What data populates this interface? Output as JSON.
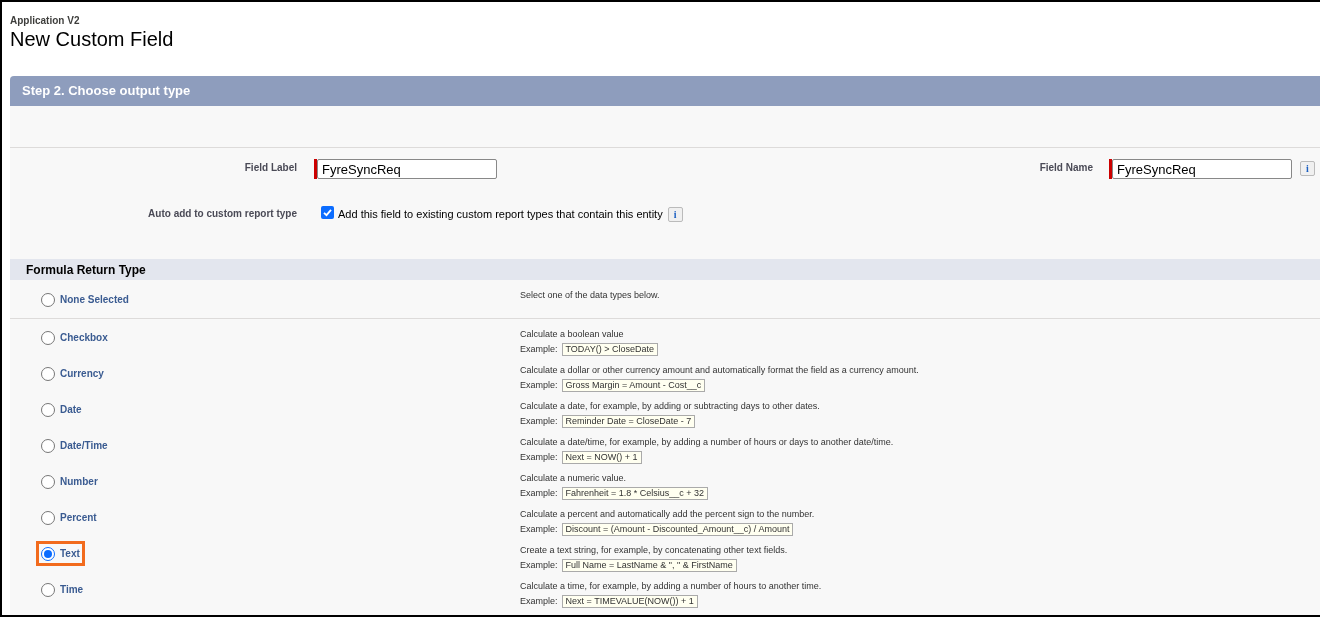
{
  "breadcrumb": "Application V2",
  "title": "New Custom Field",
  "step_header": "Step 2. Choose output type",
  "field_label": {
    "label": "Field Label",
    "value": "FyreSyncReq"
  },
  "field_name": {
    "label": "Field Name",
    "value": "FyreSyncReq",
    "info": "i"
  },
  "auto_add": {
    "label": "Auto add to custom report type",
    "checked": true,
    "text": "Add this field to existing custom report types that contain this entity",
    "info": "i"
  },
  "section_title": "Formula Return Type",
  "options": [
    {
      "label": "None Selected",
      "selected": false,
      "description": "Select one of the data types below."
    },
    {
      "label": "Checkbox",
      "selected": false,
      "description": "Calculate a boolean value",
      "example_label": "Example:",
      "example": "TODAY() > CloseDate"
    },
    {
      "label": "Currency",
      "selected": false,
      "description": "Calculate a dollar or other currency amount and automatically format the field as a currency amount.",
      "example_label": "Example:",
      "example": "Gross Margin = Amount - Cost__c"
    },
    {
      "label": "Date",
      "selected": false,
      "description": "Calculate a date, for example, by adding or subtracting days to other dates.",
      "example_label": "Example:",
      "example": "Reminder Date = CloseDate - 7"
    },
    {
      "label": "Date/Time",
      "selected": false,
      "description": "Calculate a date/time, for example, by adding a number of hours or days to another date/time.",
      "example_label": "Example:",
      "example": "Next = NOW() + 1"
    },
    {
      "label": "Number",
      "selected": false,
      "description": "Calculate a numeric value.",
      "example_label": "Example:",
      "example": "Fahrenheit = 1.8 * Celsius__c + 32"
    },
    {
      "label": "Percent",
      "selected": false,
      "description": "Calculate a percent and automatically add the percent sign to the number.",
      "example_label": "Example:",
      "example": "Discount = (Amount - Discounted_Amount__c) / Amount"
    },
    {
      "label": "Text",
      "selected": true,
      "description": "Create a text string, for example, by concatenating other text fields.",
      "example_label": "Example:",
      "example": "Full Name = LastName & \", \" & FirstName"
    },
    {
      "label": "Time",
      "selected": false,
      "description": "Calculate a time, for example, by adding a number of hours to another time.",
      "example_label": "Example:",
      "example": "Next = TIMEVALUE(NOW()) + 1"
    }
  ]
}
